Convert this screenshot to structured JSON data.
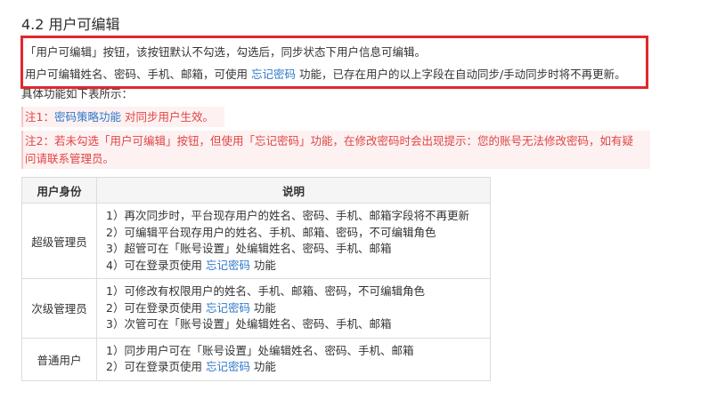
{
  "section_title": "4.2 用户可编辑",
  "box": {
    "line1": "「用户可编辑」按钮，该按钮默认不勾选，勾选后，同步状态下用户信息可编辑。",
    "line2_pre": "用户可编辑姓名、密码、手机、邮箱，可使用 ",
    "line2_link": "忘记密码",
    "line2_post": " 功能，已存在用户的以上字段在自动同步/手动同步时将不再更新。"
  },
  "intro": "具体功能如下表所示：",
  "note1": {
    "pre": "注1：",
    "link": "密码策略功能",
    "post": " 对同步用户生效。"
  },
  "note2": "注2：若未勾选「用户可编辑」按钮，但使用「忘记密码」功能，在修改密码时会出现提示：您的账号无法修改密码，如有疑问请联系管理员。",
  "table": {
    "headers": [
      "用户身份",
      "说明"
    ],
    "rows": [
      {
        "role": "超级管理员",
        "lines": [
          {
            "text": "1）再次同步时，平台现存用户的姓名、密码、手机、邮箱字段将不再更新"
          },
          {
            "text": "2）可编辑平台现存用户的姓名、手机、邮箱、密码，不可编辑角色"
          },
          {
            "text": "3）超管可在「账号设置」处编辑姓名、密码、手机、邮箱"
          },
          {
            "pre": "4）可在登录页使用 ",
            "link": "忘记密码",
            "post": " 功能"
          }
        ]
      },
      {
        "role": "次级管理员",
        "lines": [
          {
            "text": "1）可修改有权限用户的姓名、手机、邮箱、密码，不可编辑角色"
          },
          {
            "pre": "2）可在登录页使用 ",
            "link": "忘记密码",
            "post": " 功能"
          },
          {
            "text": "3）次管可在「账号设置」处编辑姓名、密码、手机、邮箱"
          }
        ]
      },
      {
        "role": "普通用户",
        "lines": [
          {
            "text": "1）同步用户可在「账号设置」处编辑姓名、密码、手机、邮箱"
          },
          {
            "pre": "2）可在登录页使用 ",
            "link": "忘记密码",
            "post": " 功能"
          }
        ]
      }
    ]
  },
  "colors": {
    "highlight_border": "#e0282e",
    "link": "#2f78c8",
    "note_text": "#e04545",
    "note_bg": "#fdf1f1",
    "table_header_bg": "#f5f5f5"
  }
}
